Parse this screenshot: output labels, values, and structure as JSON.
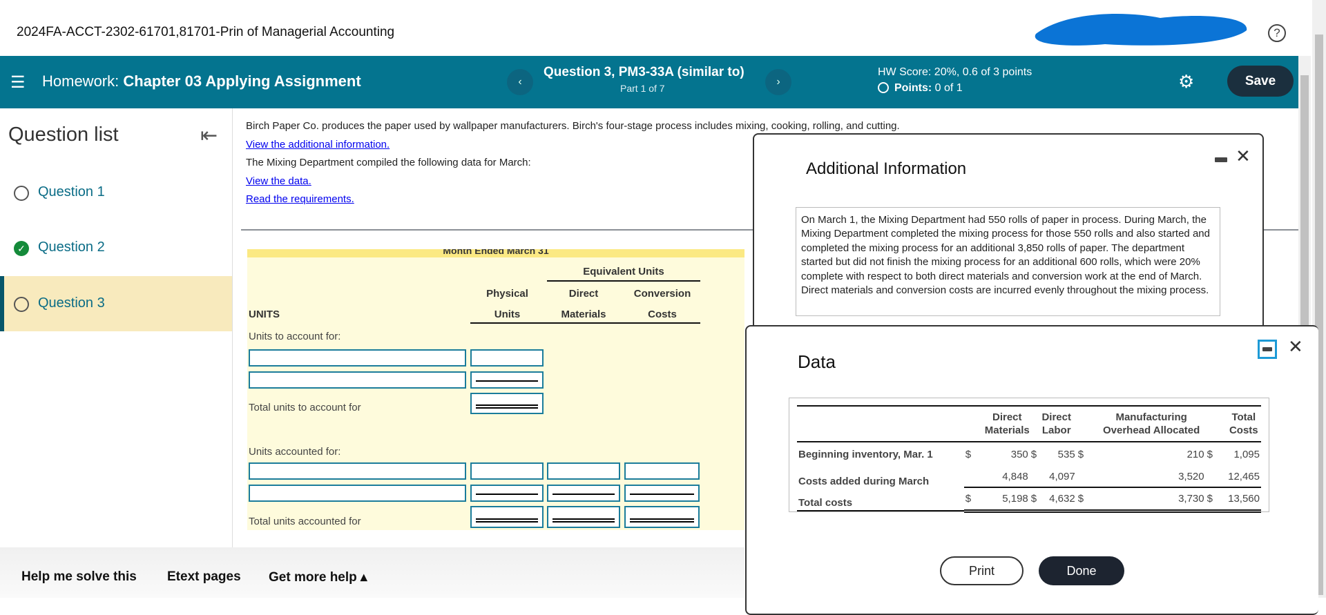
{
  "course_title": "2024FA-ACCT-2302-61701,81701-Prin of Managerial Accounting",
  "header": {
    "homework_prefix": "Homework:",
    "homework_title": "Chapter 03 Applying Assignment",
    "question_title": "Question 3, PM3-33A (similar to)",
    "part": "Part 1 of 7",
    "hw_score": "HW Score: 20%, 0.6 of 3 points",
    "points_label": "Points:",
    "points_value": "0 of 1",
    "save_label": "Save",
    "prev_icon": "‹",
    "next_icon": "›",
    "color": "#04748f"
  },
  "sidebar": {
    "title": "Question list",
    "items": [
      {
        "label": "Question 1",
        "status": "unanswered"
      },
      {
        "label": "Question 2",
        "status": "correct"
      },
      {
        "label": "Question 3",
        "status": "current"
      }
    ]
  },
  "main": {
    "intro": "Birch Paper Co. produces the paper used by wallpaper manufacturers. Birch's four-stage process includes mixing, cooking, rolling, and cutting.",
    "link_additional": "View the additional information.",
    "compiled": "The Mixing Department compiled the following data for March:",
    "link_data": "View the data.",
    "link_requirements": "Read the requirements."
  },
  "units_table": {
    "period_header": "Month Ended March 31",
    "equivalent_units": "Equivalent Units",
    "col_physical": [
      "Physical",
      "Units"
    ],
    "col_dm": [
      "Direct",
      "Materials"
    ],
    "col_cc": [
      "Conversion",
      "Costs"
    ],
    "units_label": "UNITS",
    "to_account_for": "Units to account for:",
    "total_to_account_for": "Total units to account for",
    "accounted_for": "Units accounted for:",
    "total_accounted_for": "Total units accounted for"
  },
  "footer": {
    "help": "Help me solve this",
    "etext": "Etext pages",
    "more_help": "Get more help ▴"
  },
  "additional_info": {
    "title": "Additional Information",
    "text": "On March 1, the Mixing Department had 550 rolls of paper in process. During March, the Mixing Department completed the mixing process for those 550 rolls and also started and completed the mixing process for an additional 3,850 rolls of paper. The department started but did not finish the mixing process for an additional 600 rolls, which were 20% complete with respect to both direct materials and conversion work at the end of March. Direct materials and conversion costs are incurred evenly throughout the mixing process."
  },
  "data_popup": {
    "title": "Data",
    "headers": [
      "Direct Materials",
      "Direct Labor",
      "Manufacturing Overhead Allocated",
      "Total Costs"
    ],
    "rows": [
      {
        "label": "Beginning inventory, Mar. 1",
        "dm": "350",
        "dl": "535",
        "moh": "210",
        "total": "1,095"
      },
      {
        "label": "Costs added during March",
        "dm": "4,848",
        "dl": "4,097",
        "moh": "3,520",
        "total": "12,465"
      },
      {
        "label": "Total costs",
        "dm": "5,198",
        "dl": "4,632",
        "moh": "3,730",
        "total": "13,560"
      }
    ],
    "currency": "$",
    "print_label": "Print",
    "done_label": "Done"
  }
}
